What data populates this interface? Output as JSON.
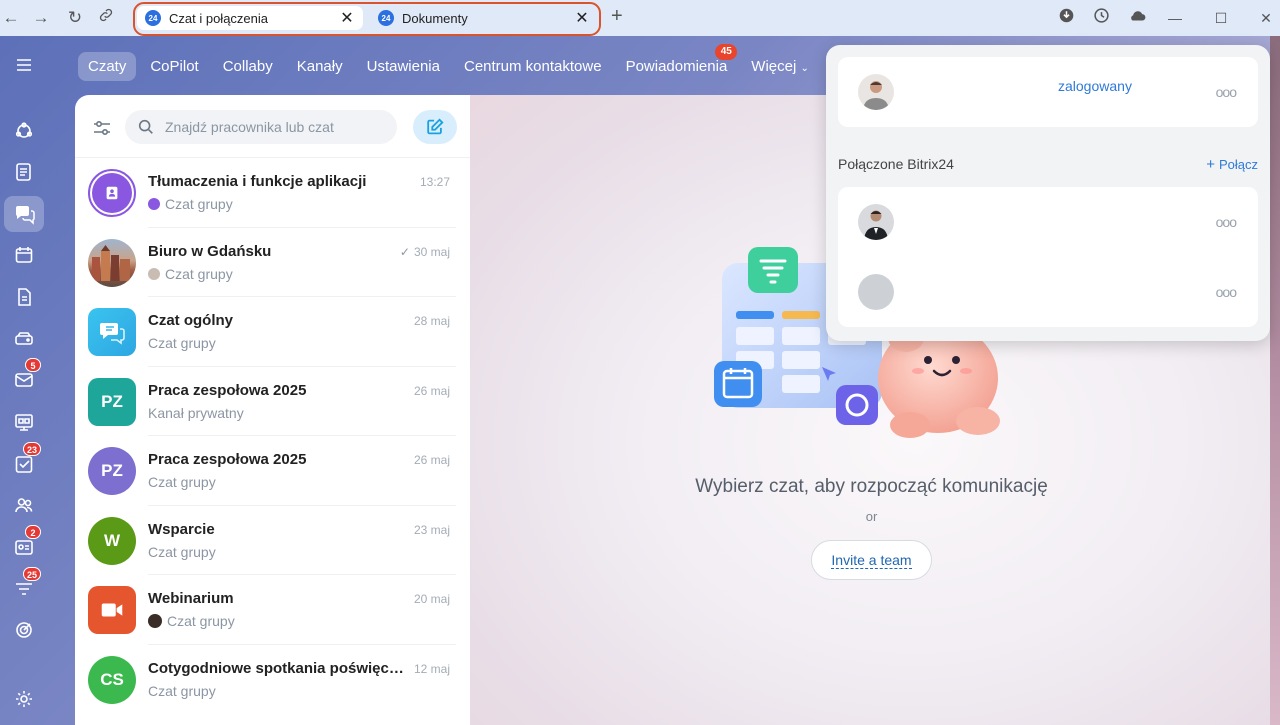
{
  "browser": {
    "tabs": [
      {
        "label": "Czat i połączenia",
        "logo": "24"
      },
      {
        "label": "Dokumenty",
        "logo": "24"
      }
    ]
  },
  "leftbar": {
    "badges": {
      "mail": "5",
      "tasks": "23",
      "crm": "2",
      "filter": "25"
    }
  },
  "topnav": {
    "items": [
      "Czaty",
      "CoPilot",
      "Collaby",
      "Kanały",
      "Ustawienia",
      "Centrum kontaktowe",
      "Powiadomienia",
      "Więcej"
    ],
    "notifications_badge": "45"
  },
  "search": {
    "placeholder": "Znajdź pracownika lub czat"
  },
  "chats": [
    {
      "title": "Tłumaczenia i funkcje aplikacji",
      "sub": "Czat grupy",
      "date": "13:27"
    },
    {
      "title": "Biuro w Gdańsku",
      "sub": "Czat grupy",
      "date": "30 maj",
      "read_mark": "✓"
    },
    {
      "title": "Czat ogólny",
      "sub": "Czat grupy",
      "date": "28 maj"
    },
    {
      "title": "Praca zespołowa 2025",
      "sub": "Kanał prywatny",
      "date": "26 maj",
      "initials": "PZ"
    },
    {
      "title": "Praca zespołowa 2025",
      "sub": "Czat grupy",
      "date": "26 maj",
      "initials": "PZ"
    },
    {
      "title": "Wsparcie",
      "sub": "Czat grupy",
      "date": "23 maj",
      "initials": "W"
    },
    {
      "title": "Webinarium",
      "sub": "Czat grupy",
      "date": "20 maj"
    },
    {
      "title": "Cotygodniowe spotkania poświęcon...",
      "sub": "Czat grupy",
      "date": "12 maj",
      "initials": "CS"
    }
  ],
  "colors": {
    "accent": "#2f7ad8",
    "pz1": "#1fa69a",
    "pz2": "#7c6fcf",
    "wsparcie": "#5b9a16",
    "webinar": "#e5552e",
    "cs": "#3cb94e",
    "tab_highlight": "#d9542c"
  },
  "main": {
    "empty_title": "Wybierz czat, aby rozpocząć komunikację",
    "or": "or",
    "invite": "Invite a team"
  },
  "dropdown": {
    "current_status": "zalogowany",
    "connected_title": "Połączone Bitrix24",
    "connect_label": "Połącz",
    "more": "ooo"
  }
}
